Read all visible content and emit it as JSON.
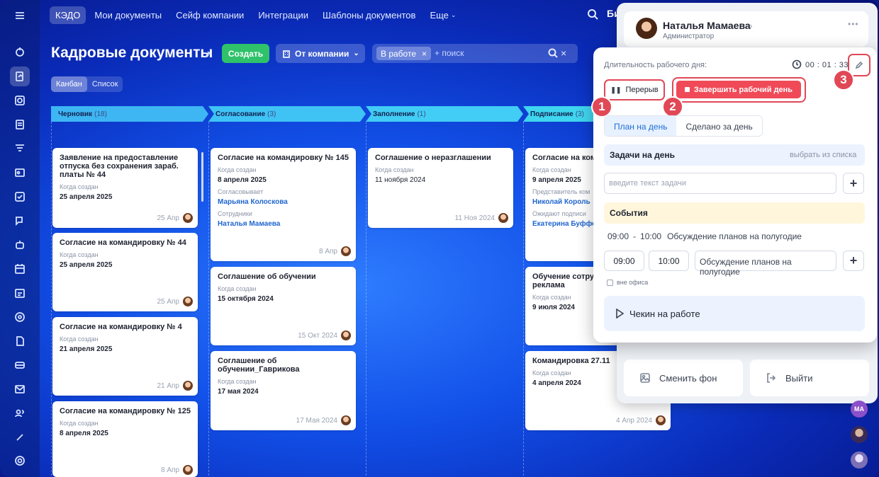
{
  "topnav": {
    "logo": "КЭДО",
    "items": [
      "Мои документы",
      "Сейф компании",
      "Интеграции",
      "Шаблоны документов"
    ],
    "more": "Еще",
    "user_short": "Би"
  },
  "page": {
    "title": "Кадровые документы",
    "create_button": "Создать",
    "company_button": "От компании",
    "filter_chip": "В работе",
    "search_placeholder": "+ поиск"
  },
  "view_tabs": [
    "Канбан",
    "Список"
  ],
  "columns": [
    {
      "name": "Черновик",
      "count": "(18)",
      "color": "#3fb8f5"
    },
    {
      "name": "Согласование",
      "count": "(3)",
      "color": "#3fc3f5"
    },
    {
      "name": "Заполнение",
      "count": "(1)",
      "color": "#3fcdf5"
    },
    {
      "name": "Подписание",
      "count": "(3)",
      "color": "#3fd7f0"
    }
  ],
  "cards": {
    "c1": {
      "title": "Заявление на предоставление отпуска без сохранения зараб. платы № 44",
      "label": "Когда создан",
      "value": "25 апреля 2025",
      "date": "25 Апр"
    },
    "c2": {
      "title": "Согласие на командировку № 44",
      "label": "Когда создан",
      "value": "25 апреля 2025",
      "date": "25 Апр"
    },
    "c3": {
      "title": "Согласие на командировку № 4",
      "label": "Когда создан",
      "value": "21 апреля 2025",
      "date": "21 Апр"
    },
    "c4": {
      "title": "Согласие на командировку № 125",
      "label": "Когда создан",
      "value": "8 апреля 2025",
      "date": "8 Апр"
    },
    "c5": {
      "title": "Согласие на командировку № 145",
      "label": "Когда создан",
      "value": "8 апреля 2025",
      "label2": "Согласовывает",
      "value2": "Марьяна Колоскова",
      "label3": "Сотрудники",
      "value3": "Наталья Мамаева",
      "date": "8 Апр"
    },
    "c6": {
      "title": "Соглашение об обучении",
      "label": "Когда создан",
      "value": "15 октября 2024",
      "date": "15 Окт 2024"
    },
    "c7": {
      "title": "Соглашение об обучении_Гаврикова",
      "label": "Когда создан",
      "value": "17 мая 2024",
      "date": "17 Мая 2024"
    },
    "c8": {
      "title": "Соглашение о неразглашении",
      "label": "Когда создан",
      "value": "11 ноября 2024",
      "date": "11 Ноя 2024"
    },
    "c9": {
      "title": "Согласие на ком",
      "label": "Когда создан",
      "value": "9 апреля 2025",
      "label2": "Представитель ком",
      "value2": "Николай Король",
      "label3": "Ожидают подписи",
      "value3": "Екатерина Буффе"
    },
    "c10": {
      "title": "Обучение сотру реклама",
      "label": "Когда создан",
      "value": "9 июля 2024"
    },
    "c11": {
      "title": "Командировка 27.11",
      "label": "Когда создан",
      "value": "4 апреля 2024",
      "date": "4 Апр 2024"
    }
  },
  "profile": {
    "name": "Наталья Мамаева",
    "role": "Администратор",
    "change_bg": "Сменить фон",
    "logout": "Выйти",
    "side_avatar_initials": "MA"
  },
  "workday": {
    "label": "Длительность рабочего дня:",
    "timer": "00 : 01 : 33",
    "break_button": "Перерыв",
    "end_button": "Завершить рабочий день",
    "tab_plan": "План на день",
    "tab_done": "Сделано за день",
    "tasks_title": "Задачи на день",
    "tasks_pick": "выбрать из списка",
    "task_placeholder": "введите текст задачи",
    "events_title": "События",
    "event_start": "09:00",
    "event_sep": "-",
    "event_end": "10:00",
    "event_text": "Обсуждение планов на полугодие",
    "field_start": "09:00",
    "field_end": "10:00",
    "field_event": "Обсуждение планов на полугодие",
    "offsite": "вне офиса",
    "checkin": "Чекин на работе"
  },
  "badges": [
    "1",
    "2",
    "3"
  ],
  "colors": {
    "accent_red": "#e04856",
    "create_green": "#2fc26a",
    "link_blue": "#2066d0"
  }
}
